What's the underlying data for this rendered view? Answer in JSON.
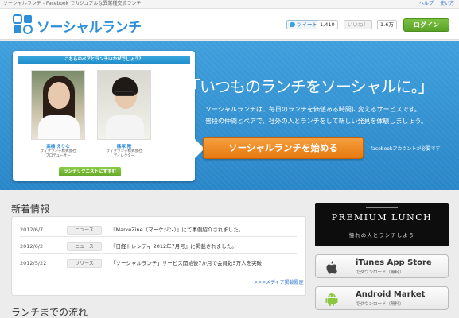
{
  "topbar": {
    "title": "ソーシャルランチ - Facebook でカジュアルな異業種交流ランチ",
    "help": "ヘルプ",
    "howto": "使い方"
  },
  "header": {
    "logo": "ソーシャルランチ",
    "tweet_label": "ツイート",
    "tweet_count": "1,410",
    "like_label": "いいね！",
    "like_count": "1.6万",
    "login_label": "ログイン"
  },
  "hero": {
    "card_title": "こちらのペアとランチいかがでしょう？",
    "person1_name": "高橋 えりな",
    "person1_role_1": "ヴィクランチ株式会社",
    "person1_role_2": "プロデューサー",
    "person2_name": "篠塚 隆",
    "person2_role_1": "ヴィクランチ株式会社",
    "person2_role_2": "ディレクター",
    "request_label": "ランチリクエストにすすむ",
    "headline": "「いつものランチをソーシャルに。」",
    "desc_line1": "ソーシャルランチは、毎日のランチを価値ある時間に変えるサービスです。",
    "desc_line2": "普段の仲間とペアで、社外の人とランチをして新しい発見を体験しましょう。",
    "start_label": "ソーシャルランチを始める",
    "fb_note": "facebookアカウントが必要です"
  },
  "news": {
    "title": "新着情報",
    "items": [
      {
        "date": "2012/6/7",
        "tag": "ニュース",
        "text": "『MarkeZine（マーケジン）』にて事例紹介されました。"
      },
      {
        "date": "2012/6/2",
        "tag": "ニュース",
        "text": "『日経トレンディ 2012年7月号』に掲載されました。"
      },
      {
        "date": "2012/5/22",
        "tag": "リリース",
        "text": "「ソーシャルランチ」サービス開始後7か月で会員数5万人を突破"
      }
    ],
    "media_link": ">>>メディア掲載履歴"
  },
  "flow": {
    "title": "ランチまでの流れ"
  },
  "side": {
    "premium_title": "PREMIUM LUNCH",
    "premium_sub": "憧れの人とランチしよう",
    "ios_name": "iTunes App Store",
    "ios_sub": "でダウンロード（無料）",
    "android_name": "Android Market",
    "android_sub": "でダウンロード（無料）"
  },
  "colors": {
    "brand_blue": "#2f8fd8",
    "hero_blue": "#2f8fd0",
    "cta_orange": "#e67a10",
    "login_green": "#5aa227"
  }
}
